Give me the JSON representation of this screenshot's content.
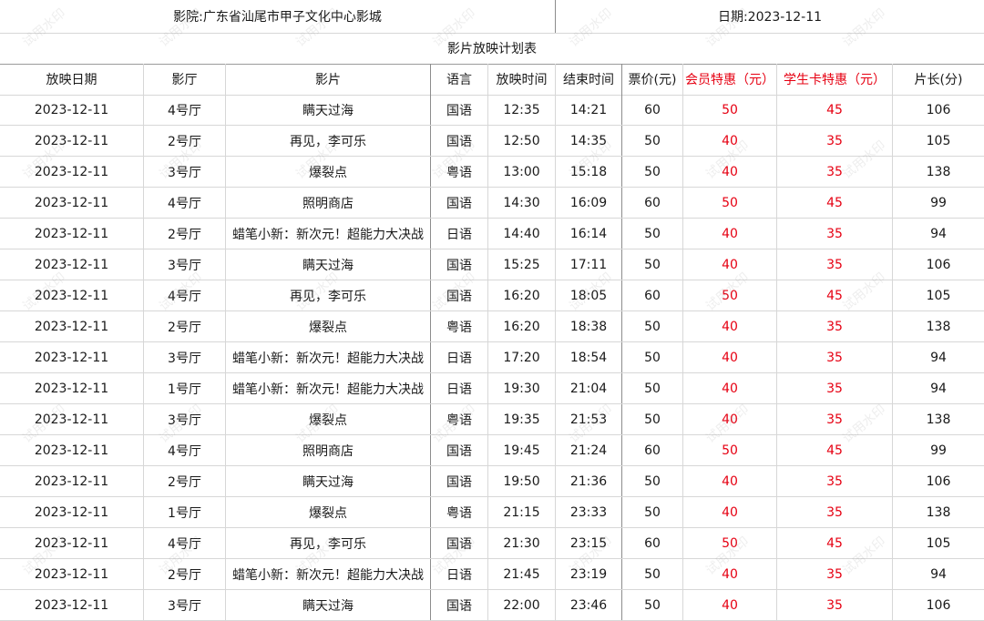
{
  "header": {
    "cinema": "影院:广东省汕尾市甲子文化中心影城",
    "date": "日期:2023-12-11",
    "title": "影片放映计划表"
  },
  "columns": [
    "放映日期",
    "影厅",
    "影片",
    "语言",
    "放映时间",
    "结束时间",
    "票价(元)",
    "会员特惠（元）",
    "学生卡特惠（元）",
    "片长(分)"
  ],
  "rows": [
    [
      "2023-12-11",
      "4号厅",
      "瞒天过海",
      "国语",
      "12:35",
      "14:21",
      "60",
      "50",
      "45",
      "106"
    ],
    [
      "2023-12-11",
      "2号厅",
      "再见，李可乐",
      "国语",
      "12:50",
      "14:35",
      "50",
      "40",
      "35",
      "105"
    ],
    [
      "2023-12-11",
      "3号厅",
      "爆裂点",
      "粤语",
      "13:00",
      "15:18",
      "50",
      "40",
      "35",
      "138"
    ],
    [
      "2023-12-11",
      "4号厅",
      "照明商店",
      "国语",
      "14:30",
      "16:09",
      "60",
      "50",
      "45",
      "99"
    ],
    [
      "2023-12-11",
      "2号厅",
      "蜡笔小新：新次元！超能力大决战",
      "日语",
      "14:40",
      "16:14",
      "50",
      "40",
      "35",
      "94"
    ],
    [
      "2023-12-11",
      "3号厅",
      "瞒天过海",
      "国语",
      "15:25",
      "17:11",
      "50",
      "40",
      "35",
      "106"
    ],
    [
      "2023-12-11",
      "4号厅",
      "再见，李可乐",
      "国语",
      "16:20",
      "18:05",
      "60",
      "50",
      "45",
      "105"
    ],
    [
      "2023-12-11",
      "2号厅",
      "爆裂点",
      "粤语",
      "16:20",
      "18:38",
      "50",
      "40",
      "35",
      "138"
    ],
    [
      "2023-12-11",
      "3号厅",
      "蜡笔小新：新次元！超能力大决战",
      "日语",
      "17:20",
      "18:54",
      "50",
      "40",
      "35",
      "94"
    ],
    [
      "2023-12-11",
      "1号厅",
      "蜡笔小新：新次元！超能力大决战",
      "日语",
      "19:30",
      "21:04",
      "50",
      "40",
      "35",
      "94"
    ],
    [
      "2023-12-11",
      "3号厅",
      "爆裂点",
      "粤语",
      "19:35",
      "21:53",
      "50",
      "40",
      "35",
      "138"
    ],
    [
      "2023-12-11",
      "4号厅",
      "照明商店",
      "国语",
      "19:45",
      "21:24",
      "60",
      "50",
      "45",
      "99"
    ],
    [
      "2023-12-11",
      "2号厅",
      "瞒天过海",
      "国语",
      "19:50",
      "21:36",
      "50",
      "40",
      "35",
      "106"
    ],
    [
      "2023-12-11",
      "1号厅",
      "爆裂点",
      "粤语",
      "21:15",
      "23:33",
      "50",
      "40",
      "35",
      "138"
    ],
    [
      "2023-12-11",
      "4号厅",
      "再见，李可乐",
      "国语",
      "21:30",
      "23:15",
      "60",
      "50",
      "45",
      "105"
    ],
    [
      "2023-12-11",
      "2号厅",
      "蜡笔小新：新次元！超能力大决战",
      "日语",
      "21:45",
      "23:19",
      "50",
      "40",
      "35",
      "94"
    ],
    [
      "2023-12-11",
      "3号厅",
      "瞒天过海",
      "国语",
      "22:00",
      "23:46",
      "50",
      "40",
      "35",
      "106"
    ]
  ],
  "watermark": "试用水印",
  "colors": {
    "accent_red": "#e60012",
    "grid": "#d7d7d7",
    "text": "#1a1a1a"
  }
}
